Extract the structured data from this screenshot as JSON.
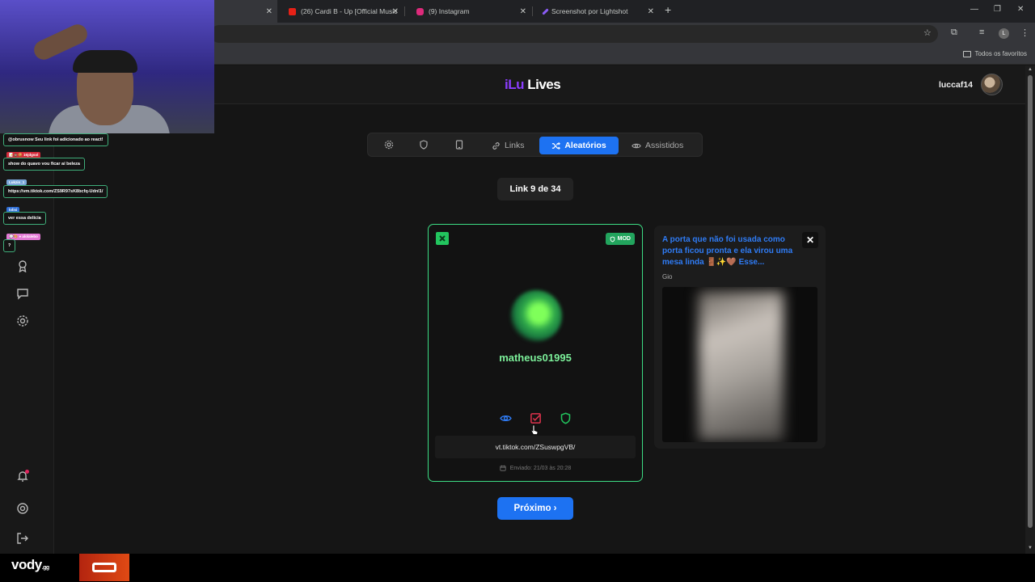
{
  "browser": {
    "tabs": [
      {
        "title": "(26) Cardi B - Up [Official Music",
        "icon": "youtube-icon",
        "color": "#e62117"
      },
      {
        "title": "(9) Instagram",
        "icon": "instagram-icon",
        "color": "#dd2a7b"
      },
      {
        "title": "Screenshot por Lightshot",
        "icon": "lightshot-icon",
        "color": "#8b5cf6"
      }
    ],
    "bookmarks_folder": "Todos os favoritos",
    "profile_initial": "L"
  },
  "header": {
    "brand_part1": "iLu",
    "brand_part2": "Lives",
    "username": "luccaf14"
  },
  "nav": {
    "links_label": "Links",
    "random_label": "Aleatórios",
    "watched_label": "Assistidos"
  },
  "counter": "Link 9 de 34",
  "card": {
    "badge": "MOD",
    "username": "matheus01995",
    "link": "vt.tiktok.com/ZSuswpgVB/",
    "date": "Enviado: 21/03 às 20:28"
  },
  "next_button": "Próximo ›",
  "preview": {
    "title": "A porta que não foi usada como porta ficou pronta e ela virou uma mesa linda 🚪✨🤎 Esse...",
    "author": "Gio",
    "close": "✕"
  },
  "chat": {
    "messages": [
      {
        "tag": "",
        "text": "@obrusnow Seu link foi adicionado ao react!"
      },
      {
        "tag": "📝💩🍪 16jdgsol",
        "text": "show do quavo vou ficar aí beleza"
      },
      {
        "tag": "Lukzin_1",
        "text": "https://vm.tiktok.com/ZS9R97sK8bcfq-Udnl1/"
      },
      {
        "tag": "lolisi",
        "text": "ver essa delícia"
      },
      {
        "tag": "💬🎨 ● alolalebo",
        "text": "?"
      }
    ]
  },
  "bottom": {
    "brand": "vody",
    "brand_suffix": ".gg"
  },
  "colors": {
    "accent": "#1d72f2",
    "success": "#3ddc84",
    "brand_purple": "#8b3dff"
  }
}
